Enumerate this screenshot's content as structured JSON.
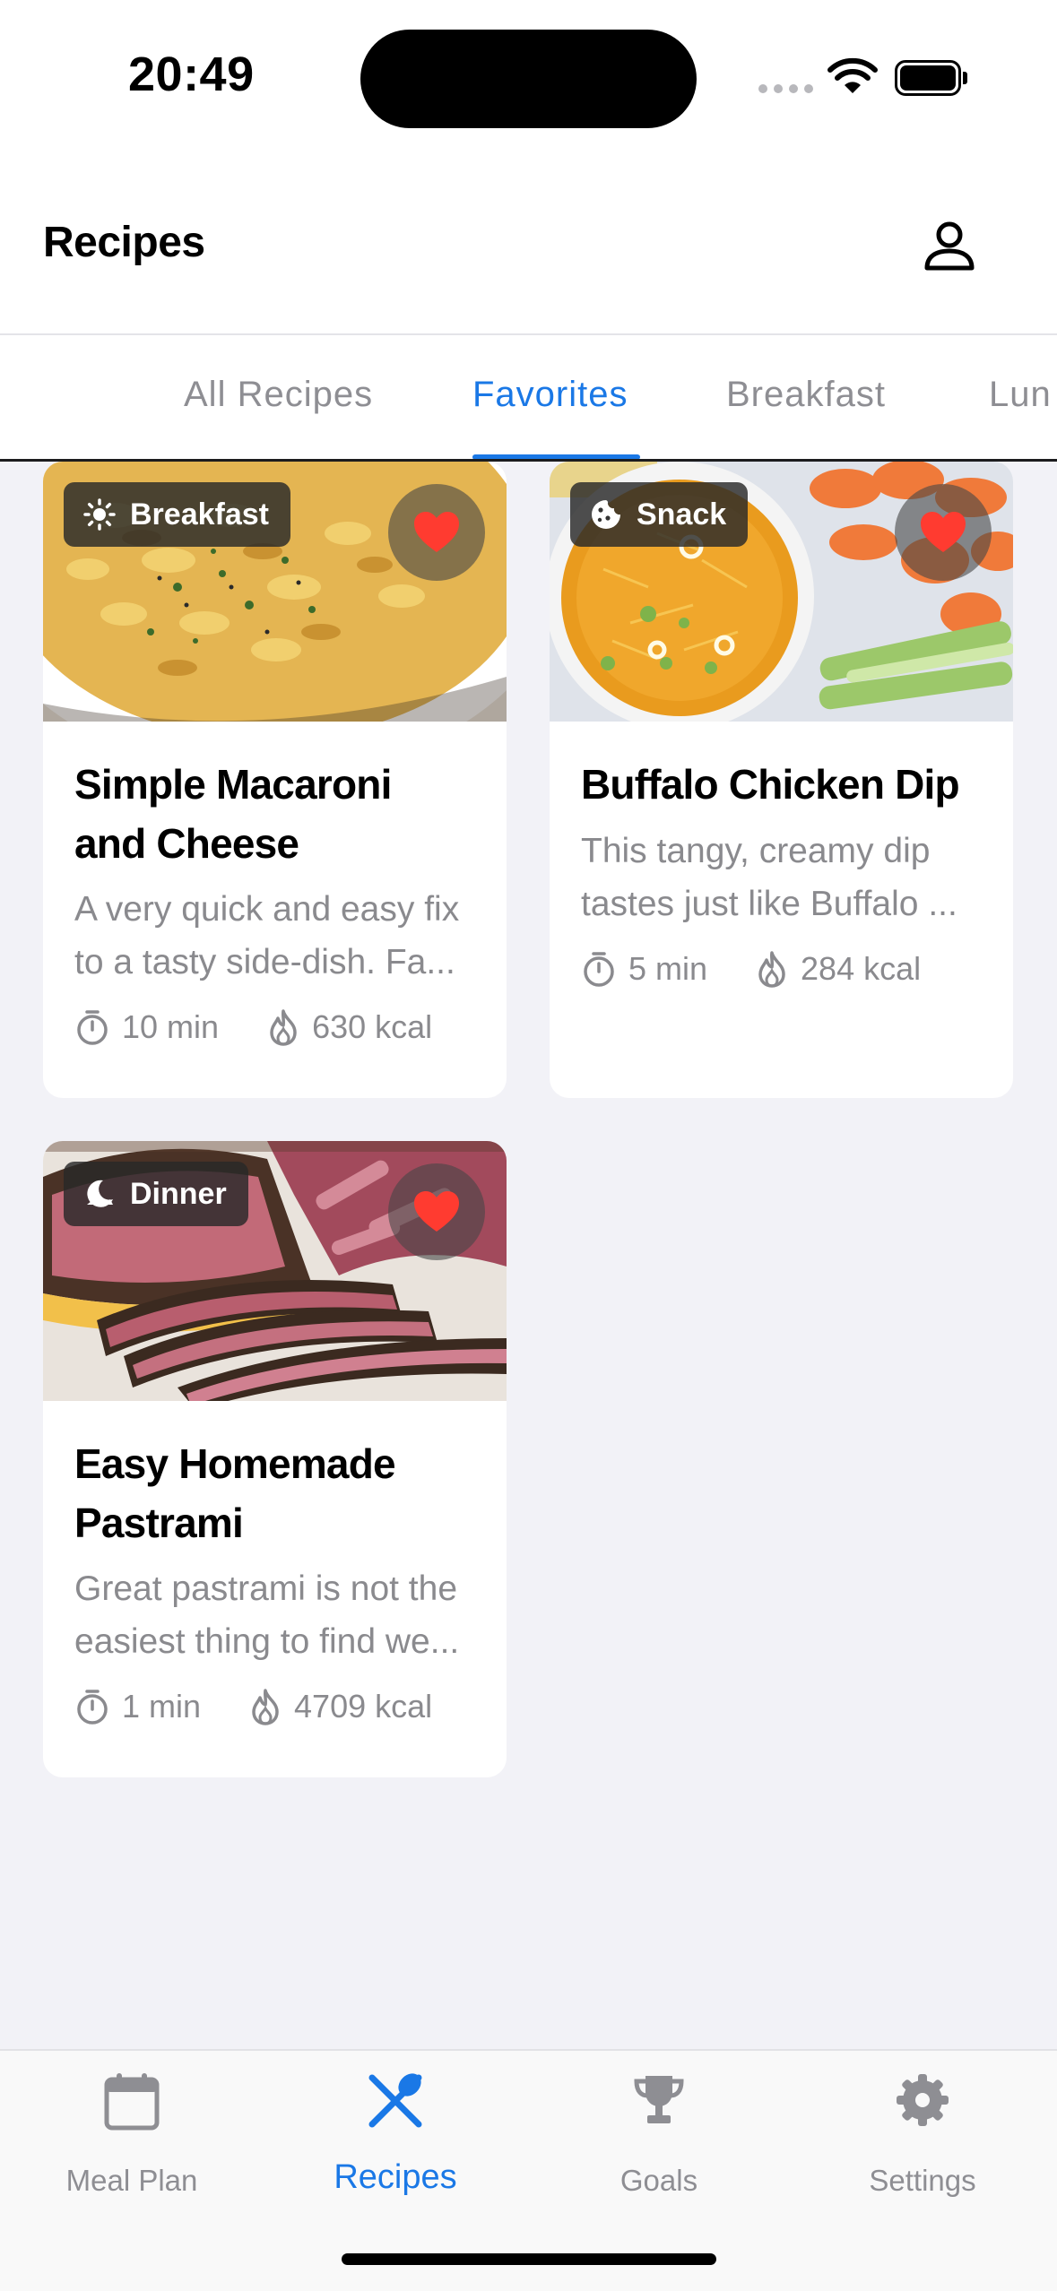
{
  "status_bar": {
    "time": "20:49"
  },
  "header": {
    "title": "Recipes",
    "profile_icon": "person-icon"
  },
  "tabs": [
    {
      "label": "All Recipes",
      "active": false
    },
    {
      "label": "Favorites",
      "active": true
    },
    {
      "label": "Breakfast",
      "active": false
    },
    {
      "label": "Lun",
      "active": false
    }
  ],
  "recipes": [
    {
      "category": "Breakfast",
      "category_icon": "sun-icon",
      "favorite": true,
      "title_lines": [
        "Simple Macaroni",
        "and Cheese"
      ],
      "description_lines": [
        "A very quick and easy fix",
        "to a tasty side-dish. Fa..."
      ],
      "time": "10 min",
      "calories": "630 kcal"
    },
    {
      "category": "Snack",
      "category_icon": "cookie-icon",
      "favorite": true,
      "title_lines": [
        "Buffalo Chicken Dip"
      ],
      "description_lines": [
        "This tangy, creamy dip",
        "tastes just like Buffalo ..."
      ],
      "time": "5 min",
      "calories": "284 kcal"
    },
    {
      "category": "Dinner",
      "category_icon": "moon-icon",
      "favorite": true,
      "title_lines": [
        "Easy Homemade",
        "Pastrami"
      ],
      "description_lines": [
        "Great pastrami is not the",
        "easiest thing to find we..."
      ],
      "time": "1 min",
      "calories": "4709 kcal"
    }
  ],
  "tab_bar": [
    {
      "label": "Meal Plan",
      "icon": "calendar-icon",
      "active": false
    },
    {
      "label": "Recipes",
      "icon": "fork-knife-icon",
      "active": true
    },
    {
      "label": "Goals",
      "icon": "trophy-icon",
      "active": false
    },
    {
      "label": "Settings",
      "icon": "gear-icon",
      "active": false
    }
  ],
  "colors": {
    "accent": "#1a78e6",
    "heart": "#ff3b30",
    "background": "#f2f2f7"
  }
}
